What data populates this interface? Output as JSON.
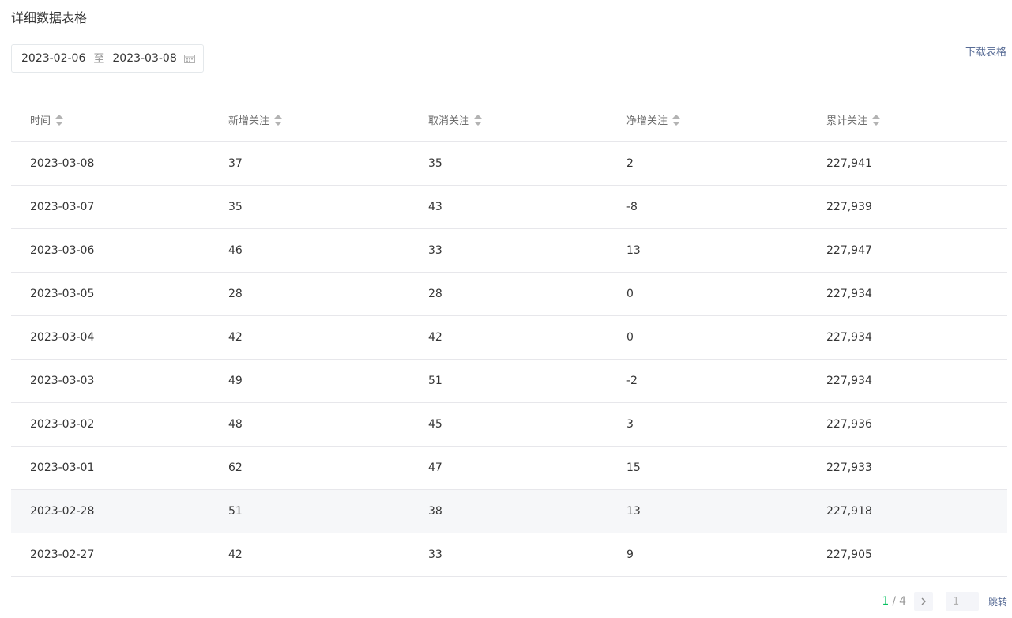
{
  "section_title": "详细数据表格",
  "date_range": {
    "start": "2023-02-06",
    "separator": "至",
    "end": "2023-03-08",
    "icon": "calendar-icon"
  },
  "download_label": "下载表格",
  "table": {
    "columns": [
      "时间",
      "新增关注",
      "取消关注",
      "净增关注",
      "累计关注"
    ],
    "rows": [
      [
        "2023-03-08",
        "37",
        "35",
        "2",
        "227,941"
      ],
      [
        "2023-03-07",
        "35",
        "43",
        "-8",
        "227,939"
      ],
      [
        "2023-03-06",
        "46",
        "33",
        "13",
        "227,947"
      ],
      [
        "2023-03-05",
        "28",
        "28",
        "0",
        "227,934"
      ],
      [
        "2023-03-04",
        "42",
        "42",
        "0",
        "227,934"
      ],
      [
        "2023-03-03",
        "49",
        "51",
        "-2",
        "227,934"
      ],
      [
        "2023-03-02",
        "48",
        "45",
        "3",
        "227,936"
      ],
      [
        "2023-03-01",
        "62",
        "47",
        "15",
        "227,933"
      ],
      [
        "2023-02-28",
        "51",
        "38",
        "13",
        "227,918"
      ],
      [
        "2023-02-27",
        "42",
        "33",
        "9",
        "227,905"
      ]
    ],
    "highlighted_row": 8
  },
  "pagination": {
    "current": "1",
    "separator": "/",
    "total": "4",
    "input_placeholder": "1",
    "jump_label": "跳转",
    "next_icon": "chevron-right-icon"
  },
  "colors": {
    "accent_green": "#07c160",
    "link_blue": "#576b95",
    "row_hover": "#f6f7f9"
  }
}
